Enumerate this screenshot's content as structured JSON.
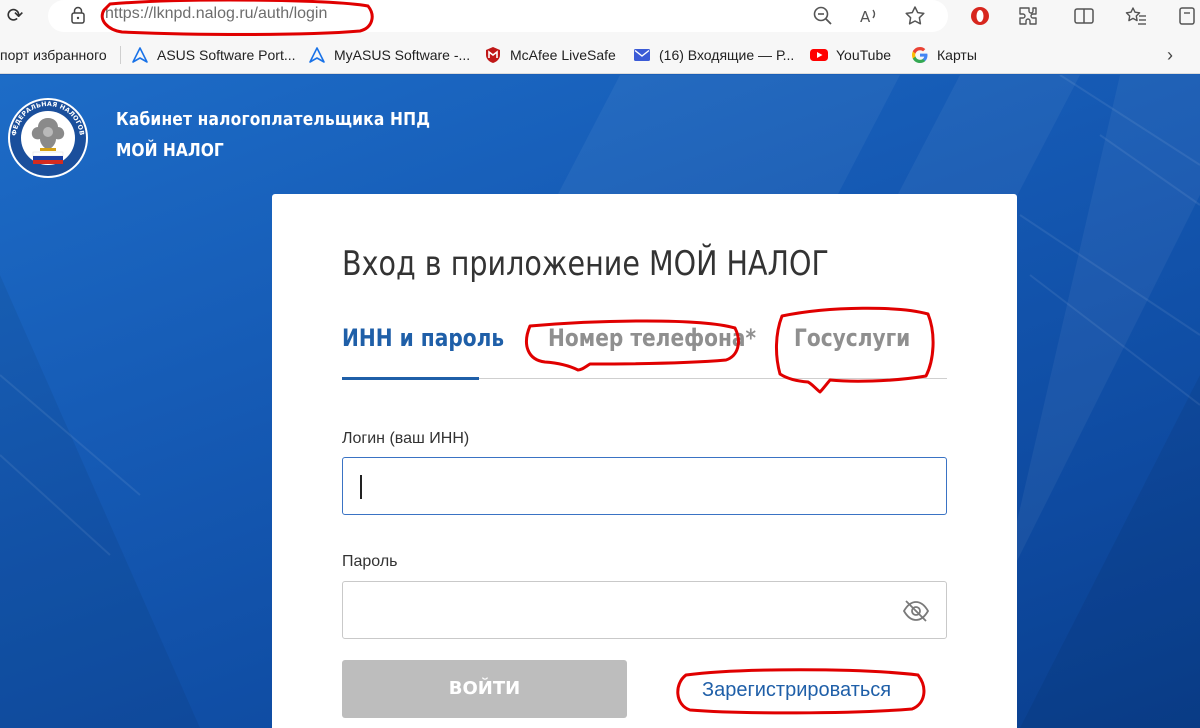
{
  "browser": {
    "url_main": "https://lknpd.nalog.ru",
    "url_path": "/auth/login",
    "icons": [
      "reload-icon",
      "lock-icon",
      "zoom-out-icon",
      "read-aloud-icon",
      "favorite-star-icon",
      "opera-extension-icon",
      "extensions-icon",
      "split-screen-icon",
      "favorites-icon",
      "collections-icon"
    ]
  },
  "bookmarks": [
    {
      "label": "порт избранного"
    },
    {
      "label": "ASUS Software Port..."
    },
    {
      "label": "MyASUS Software -..."
    },
    {
      "label": "McAfee LiveSafe"
    },
    {
      "label": "(16) Входящие — Р..."
    },
    {
      "label": "YouTube"
    },
    {
      "label": "Карты"
    }
  ],
  "brand": {
    "line1": "Кабинет налогоплательщика НПД",
    "line2": "МОЙ НАЛОГ",
    "emblem_text": "ФЕДЕРАЛЬНАЯ НАЛОГОВАЯ СЛУЖБА"
  },
  "login": {
    "title": "Вход в приложение МОЙ НАЛОГ",
    "tabs": [
      {
        "label": "ИНН и пароль",
        "active": true
      },
      {
        "label": "Номер телефона*",
        "active": false
      },
      {
        "label": "Госуслуги",
        "active": false
      }
    ],
    "login_label": "Логин (ваш ИНН)",
    "login_value": "",
    "password_label": "Пароль",
    "password_value": "",
    "submit_label": "ВОЙТИ",
    "register_label": "Зарегистрироваться"
  },
  "colors": {
    "accent": "#1f5fa8",
    "background": "#1559b3",
    "annotation": "#e00000",
    "disabled_button": "#bdbdbd"
  }
}
